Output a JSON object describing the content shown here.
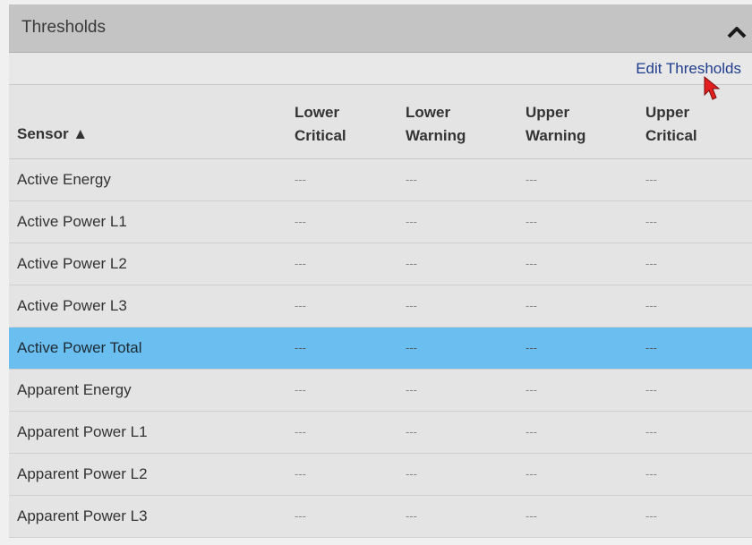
{
  "panel": {
    "title": "Thresholds",
    "collapse_icon": "chevron-up-icon",
    "edit_link": "Edit Thresholds",
    "cursor_icon": "mouse-pointer-icon"
  },
  "colors": {
    "header_bg": "#c4c4c4",
    "row_bg": "#e4e4e4",
    "selected_row_bg": "#6bbff0",
    "link": "#1f3d8c",
    "cursor": "#e32020"
  },
  "table": {
    "columns": [
      {
        "line1": "Sensor ▲",
        "line2": ""
      },
      {
        "line1": "Lower",
        "line2": "Critical"
      },
      {
        "line1": "Lower",
        "line2": "Warning"
      },
      {
        "line1": "Upper",
        "line2": "Warning"
      },
      {
        "line1": "Upper",
        "line2": "Critical"
      }
    ],
    "rows": [
      {
        "sensor": "Active Energy",
        "values": [
          "---",
          "---",
          "---",
          "---"
        ],
        "selected": false
      },
      {
        "sensor": "Active Power L1",
        "values": [
          "---",
          "---",
          "---",
          "---"
        ],
        "selected": false
      },
      {
        "sensor": "Active Power L2",
        "values": [
          "---",
          "---",
          "---",
          "---"
        ],
        "selected": false
      },
      {
        "sensor": "Active Power L3",
        "values": [
          "---",
          "---",
          "---",
          "---"
        ],
        "selected": false
      },
      {
        "sensor": "Active Power Total",
        "values": [
          "---",
          "---",
          "---",
          "---"
        ],
        "selected": true
      },
      {
        "sensor": "Apparent Energy",
        "values": [
          "---",
          "---",
          "---",
          "---"
        ],
        "selected": false
      },
      {
        "sensor": "Apparent Power L1",
        "values": [
          "---",
          "---",
          "---",
          "---"
        ],
        "selected": false
      },
      {
        "sensor": "Apparent Power L2",
        "values": [
          "---",
          "---",
          "---",
          "---"
        ],
        "selected": false
      },
      {
        "sensor": "Apparent Power L3",
        "values": [
          "---",
          "---",
          "---",
          "---"
        ],
        "selected": false
      }
    ]
  }
}
